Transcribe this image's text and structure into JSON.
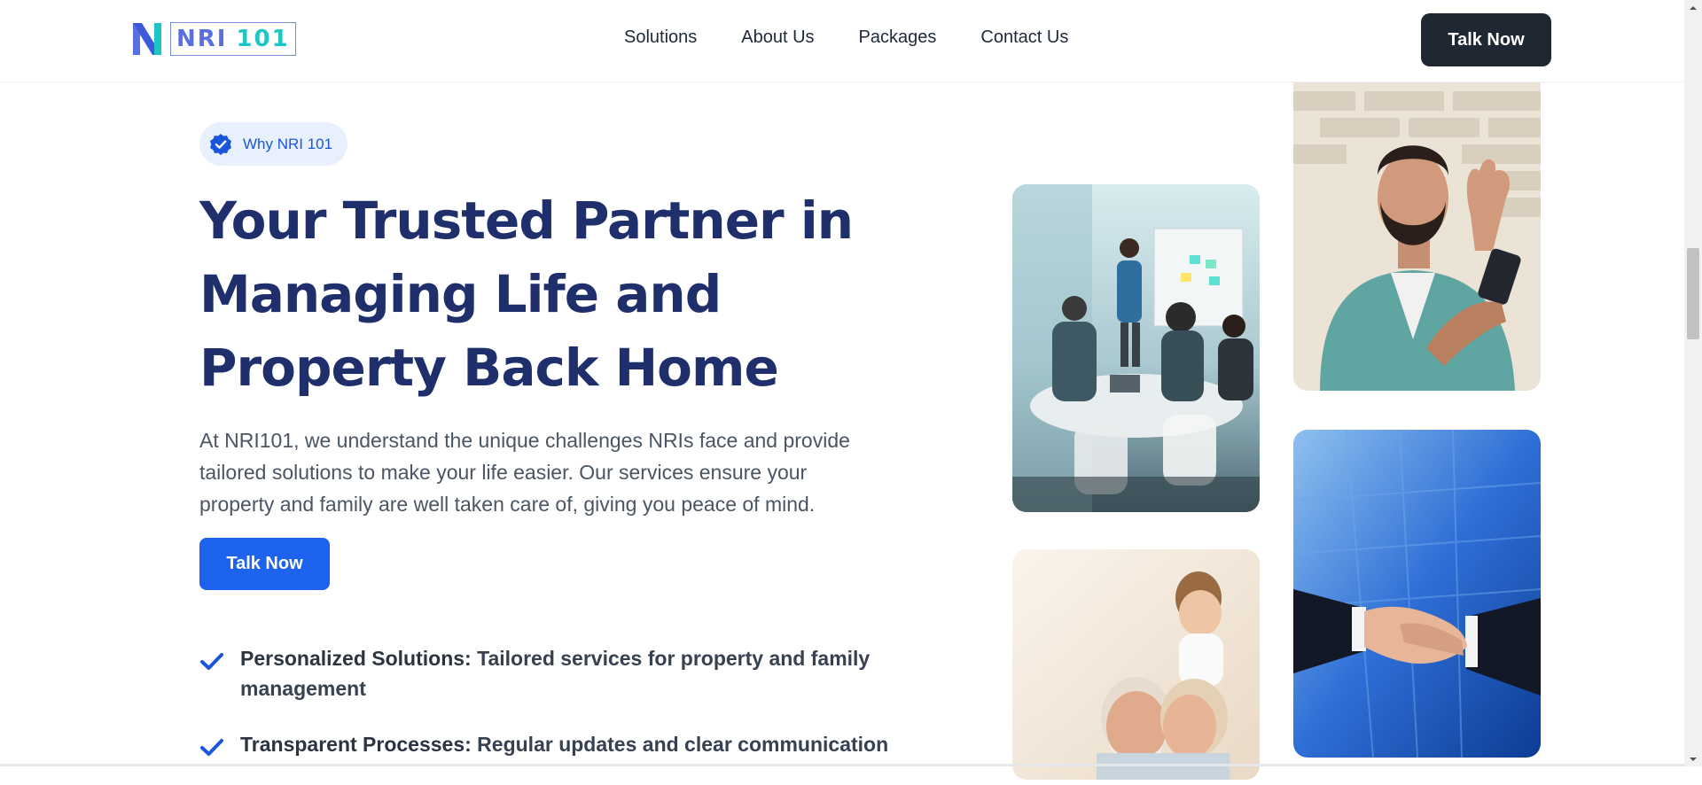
{
  "brand": {
    "logo_nri": "NRI",
    "logo_101": "101",
    "colors": {
      "primary": "#1d63ed",
      "navy": "#1e2f6b",
      "dark": "#1f2733",
      "teal": "#1fc6c6"
    }
  },
  "nav": {
    "items": [
      {
        "label": "Solutions"
      },
      {
        "label": "About Us"
      },
      {
        "label": "Packages"
      },
      {
        "label": "Contact Us"
      }
    ],
    "cta_label": "Talk Now"
  },
  "hero": {
    "badge": {
      "icon": "verified-check-icon",
      "label": "Why NRI 101"
    },
    "headline_lines": [
      "Your Trusted Partner in",
      "Managing Life and",
      "Property Back Home"
    ],
    "intro_lines": [
      "At NRI101, we understand the unique challenges NRIs face and provide",
      "tailored solutions to make your life easier. Our services ensure your",
      "property and family are well taken care of, giving you peace of mind."
    ],
    "cta_label": "Talk Now",
    "features": [
      {
        "icon": "checkmark-icon",
        "title": "Personalized Solutions:",
        "text": " Tailored services for property and family management"
      },
      {
        "icon": "checkmark-icon",
        "title": "Transparent Processes:",
        "text": " Regular updates and clear communication"
      }
    ]
  },
  "photos": [
    {
      "name": "meeting-photo"
    },
    {
      "name": "man-video-call-photo"
    },
    {
      "name": "family-photo"
    },
    {
      "name": "handshake-photo"
    }
  ]
}
